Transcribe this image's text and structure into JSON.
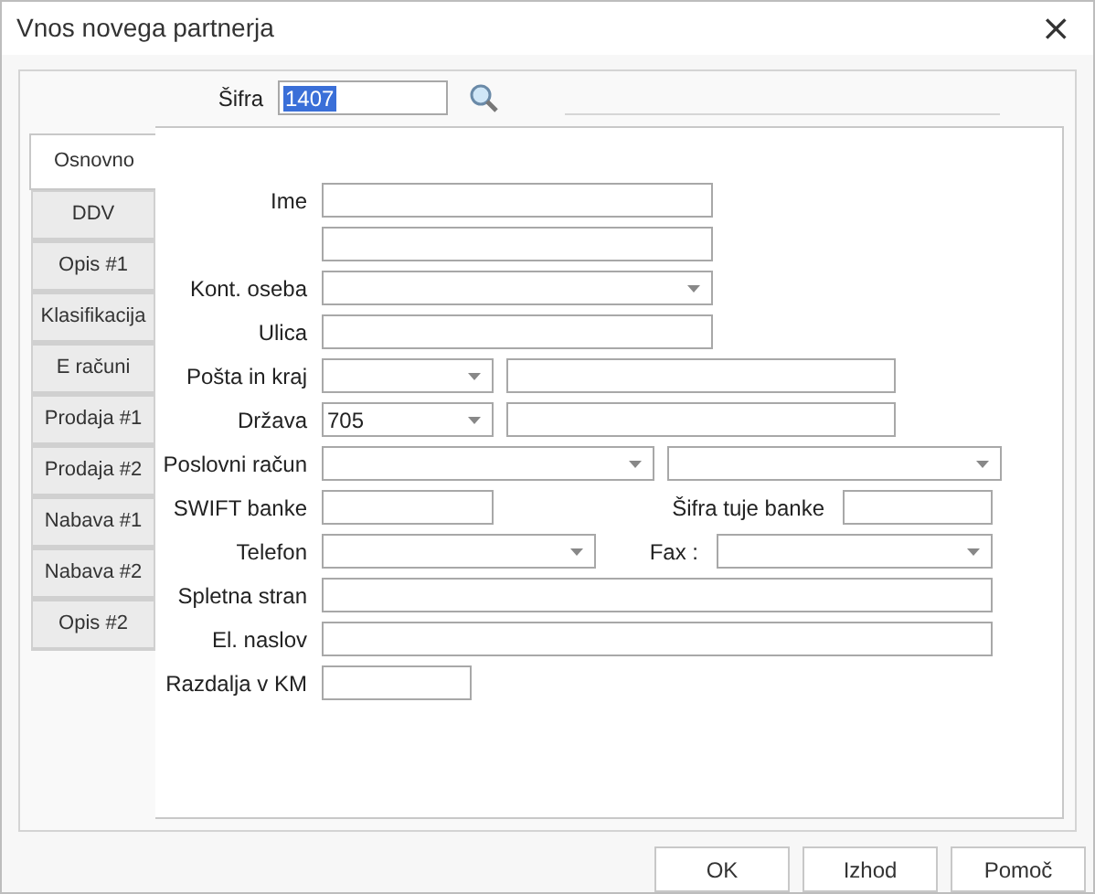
{
  "window": {
    "title": "Vnos novega partnerja",
    "close": "×"
  },
  "header": {
    "label": "Šifra",
    "value": "1407"
  },
  "tabs": [
    {
      "label": "Osnovno",
      "selected": true
    },
    {
      "label": "DDV",
      "selected": false
    },
    {
      "label": "Opis #1",
      "selected": false
    },
    {
      "label": "Klasifikacija",
      "selected": false
    },
    {
      "label": "E računi",
      "selected": false
    },
    {
      "label": "Prodaja #1",
      "selected": false
    },
    {
      "label": "Prodaja #2",
      "selected": false
    },
    {
      "label": "Nabava #1",
      "selected": false
    },
    {
      "label": "Nabava #2",
      "selected": false
    },
    {
      "label": "Opis #2",
      "selected": false
    }
  ],
  "form": [
    {
      "label": "Ime",
      "fields": [
        {
          "kind": "text"
        }
      ]
    },
    {
      "fields": [
        {
          "kind": "text"
        }
      ]
    },
    {
      "label": "Kont. oseba",
      "fields": [
        {
          "kind": "combo"
        }
      ]
    },
    {
      "label": "Ulica",
      "fields": [
        {
          "kind": "text"
        }
      ]
    },
    {
      "label": "Pošta in kraj",
      "fields": [
        {
          "kind": "combo"
        },
        {
          "kind": "text"
        }
      ]
    },
    {
      "label": "Država",
      "fields": [
        {
          "kind": "combo",
          "value": "705"
        },
        {
          "kind": "text"
        }
      ]
    },
    {
      "label": "Poslovni račun",
      "fields": [
        {
          "kind": "combo"
        },
        {
          "kind": "combo"
        }
      ]
    },
    {
      "label": "SWIFT banke",
      "fields": [
        {
          "kind": "text"
        },
        {
          "kind": "text",
          "label": "Šifra tuje banke"
        }
      ]
    },
    {
      "label": "Telefon",
      "fields": [
        {
          "kind": "combo"
        },
        {
          "kind": "combo",
          "label": "Fax :"
        }
      ]
    },
    {
      "label": "Spletna stran",
      "fields": [
        {
          "kind": "text"
        }
      ]
    },
    {
      "label": "El. naslov",
      "fields": [
        {
          "kind": "text"
        }
      ]
    },
    {
      "label": "Razdalja v KM",
      "fields": [
        {
          "kind": "text"
        }
      ]
    }
  ],
  "buttons": [
    "OK",
    "Izhod",
    "Pomoč"
  ]
}
